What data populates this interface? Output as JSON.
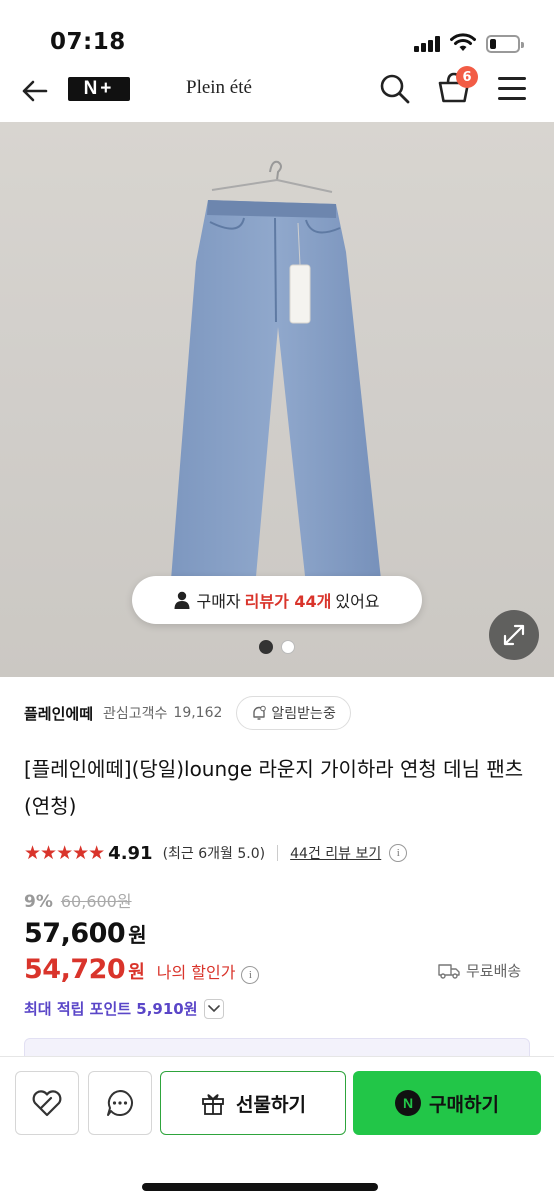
{
  "status_bar": {
    "time": "07:18"
  },
  "header": {
    "logo": "N+",
    "brand": "Plein été",
    "cart_count": "6"
  },
  "gallery": {
    "review_pill": {
      "prefix": "구매자",
      "highlight": "리뷰가 44개",
      "suffix": "있어요"
    },
    "current_slide": 1,
    "total_slides": 2
  },
  "shop": {
    "name": "플레인에떼",
    "interest_label": "관심고객수",
    "interest_count": "19,162",
    "alert_label": "알림받는중"
  },
  "product": {
    "title": "[플레인에떼](당일)lounge 라운지 가이하라 연청 데님 팬츠 (연청)"
  },
  "rating": {
    "stars": "★★★★★",
    "value": "4.91",
    "recent": "(최근 6개월 5.0)",
    "review_link": "44건 리뷰 보기"
  },
  "price": {
    "discount_rate": "9%",
    "original": "60,600원",
    "sale": "57,600",
    "sale_unit": "원",
    "my_price": "54,720",
    "my_price_unit": "원",
    "my_price_label": "나의 할인가",
    "shipping": "무료배송",
    "points": "최대 적립 포인트 5,910원"
  },
  "bottom_bar": {
    "gift_label": "선물하기",
    "buy_label": "구매하기",
    "npay": "N"
  },
  "colors": {
    "accent_red": "#d9342b",
    "naver_green": "#22c648",
    "points_purple": "#5a46c8"
  }
}
